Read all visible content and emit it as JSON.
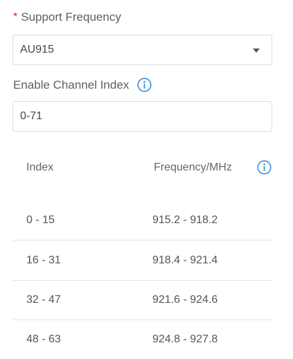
{
  "support_frequency": {
    "required_mark": "*",
    "label": "Support Frequency",
    "value": "AU915"
  },
  "channel_index": {
    "label": "Enable Channel Index",
    "value": "0-71"
  },
  "table": {
    "columns": [
      "Index",
      "Frequency/MHz"
    ],
    "rows": [
      {
        "index": "0 - 15",
        "frequency": "915.2 - 918.2"
      },
      {
        "index": "16 - 31",
        "frequency": "918.4 - 921.4"
      },
      {
        "index": "32 - 47",
        "frequency": "921.6 - 924.6"
      },
      {
        "index": "48 - 63",
        "frequency": "924.8 - 927.8"
      }
    ]
  },
  "icons": {
    "info": "info-circle-icon",
    "dropdown": "caret-down-icon"
  },
  "colors": {
    "accent": "#3b8ed8",
    "required": "#e02424"
  }
}
